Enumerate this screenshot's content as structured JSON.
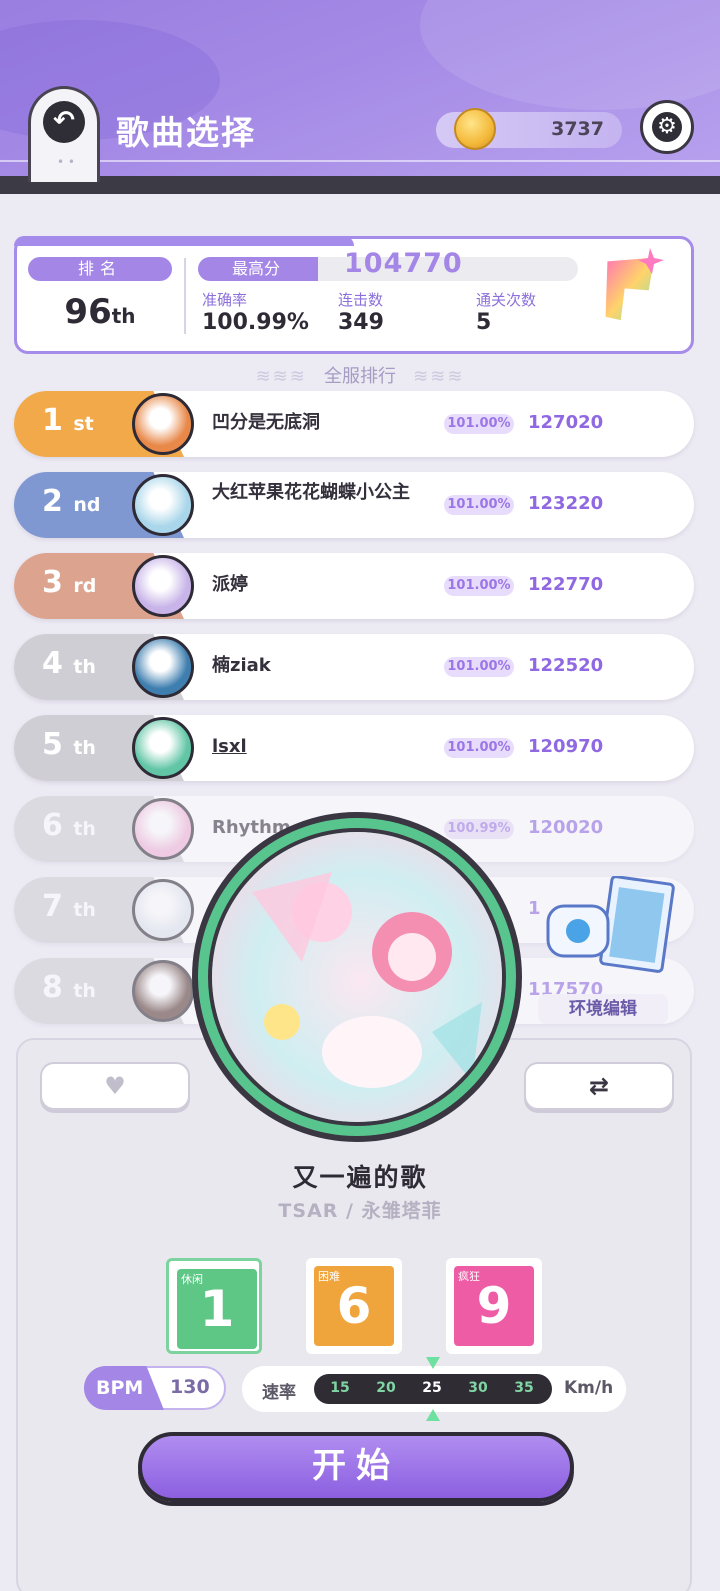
{
  "header": {
    "title": "歌曲选择",
    "coins": "3737",
    "back_icon": "back-arrow-icon",
    "settings_icon": "gear-icon"
  },
  "stats": {
    "rank_label": "排名",
    "rank_value": "96",
    "rank_suffix": "th",
    "best_label": "最高分",
    "best_score": "104770",
    "accuracy_label": "准确率",
    "accuracy_value": "100.99%",
    "combo_label": "连击数",
    "combo_value": "349",
    "clears_label": "通关次数",
    "clears_value": "5"
  },
  "global_rank_label": "全服排行",
  "leaderboard": [
    {
      "rank": "1",
      "suffix": "st",
      "name": "凹分是无底洞",
      "accuracy": "101.00%",
      "score": "127020",
      "color": "#f1a94a"
    },
    {
      "rank": "2",
      "suffix": "nd",
      "name": "大红苹果花花蝴蝶小公主",
      "accuracy": "101.00%",
      "score": "123220",
      "color": "#7f98d2"
    },
    {
      "rank": "3",
      "suffix": "rd",
      "name": "派婷",
      "accuracy": "101.00%",
      "score": "122770",
      "color": "#dca48f"
    },
    {
      "rank": "4",
      "suffix": "th",
      "name": "楠ziak",
      "accuracy": "101.00%",
      "score": "122520",
      "color": "#cfced4"
    },
    {
      "rank": "5",
      "suffix": "th",
      "name": "lsxl",
      "accuracy": "101.00%",
      "score": "120970",
      "color": "#cfced4"
    },
    {
      "rank": "6",
      "suffix": "th",
      "name": "Rhythm",
      "accuracy": "100.99%",
      "score": "120020",
      "color": "#cfced4"
    },
    {
      "rank": "7",
      "suffix": "th",
      "name": "",
      "accuracy": "",
      "score": "1",
      "color": "#cfced4"
    },
    {
      "rank": "8",
      "suffix": "th",
      "name": "",
      "accuracy": "",
      "score": "117570",
      "color": "#cfced4"
    }
  ],
  "environment_edit_label": "环境编辑",
  "song": {
    "title": "又一遍的歌",
    "artist": "TSAR / 永雏塔菲"
  },
  "difficulties": [
    {
      "label": "休闲",
      "level": "1",
      "color": "#5fc786"
    },
    {
      "label": "困难",
      "level": "6",
      "color": "#f0a43c"
    },
    {
      "label": "疯狂",
      "level": "9",
      "color": "#ee5ca6"
    }
  ],
  "bpm": {
    "label": "BPM",
    "value": "130"
  },
  "speed": {
    "label": "速率",
    "ticks": [
      "15",
      "20",
      "25",
      "30",
      "35"
    ],
    "selected": "25",
    "unit": "Km/h"
  },
  "start_label": "开始",
  "colors": {
    "accent": "#a486e6",
    "header": "#a58be6"
  }
}
